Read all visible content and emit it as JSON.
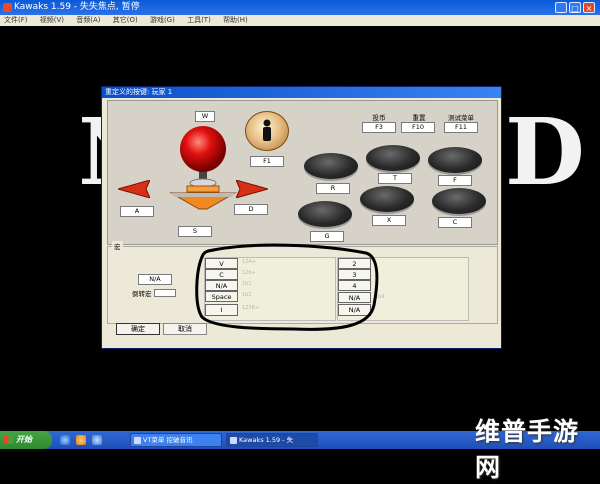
{
  "window": {
    "title": "Kawaks 1.59 - 失失焦点, 暂停"
  },
  "menu": [
    "文件(F)",
    "视频(V)",
    "音频(A)",
    "其它(O)",
    "游戏(G)",
    "工具(T)",
    "帮助(H)"
  ],
  "background_text": [
    "N",
    "D"
  ],
  "dialog": {
    "title": "重定义的按键: 玩家 1",
    "direction": {
      "up": "W",
      "down": "S",
      "left": "A",
      "right": "D"
    },
    "start_button_key": "F1",
    "top_labels": [
      {
        "label": "投币",
        "key": "F3"
      },
      {
        "label": "重置",
        "key": "F10"
      },
      {
        "label": "测试菜单",
        "key": "F11"
      }
    ],
    "buttons": {
      "b1": "R",
      "b2": "T",
      "b3": "F",
      "b4": "G",
      "b5": "X",
      "b6": "C"
    },
    "macro": {
      "legend": "宏",
      "key": "N/A",
      "reverse_label": "倒转宏",
      "left_keys": [
        "V",
        "C",
        "N/A",
        "Space",
        "I"
      ],
      "left_hints": [
        "12A+",
        "12b+",
        "1b1",
        "1b2",
        "123B+"
      ],
      "right_keys": [
        "2",
        "3",
        "4",
        "N/A",
        "N/A"
      ],
      "right_hint": "1b4"
    },
    "ok": "确定",
    "cancel": "取消"
  },
  "taskbar": {
    "start": "开始",
    "tasks": [
      "VT菜单 挖破音讯",
      "Kawaks 1.59 - 失"
    ]
  },
  "watermark": "维普手游网",
  "colors": {
    "titlebar": "#0a5ad8",
    "dialog_bg": "#ece9d8",
    "taskbar": "#245edb"
  }
}
